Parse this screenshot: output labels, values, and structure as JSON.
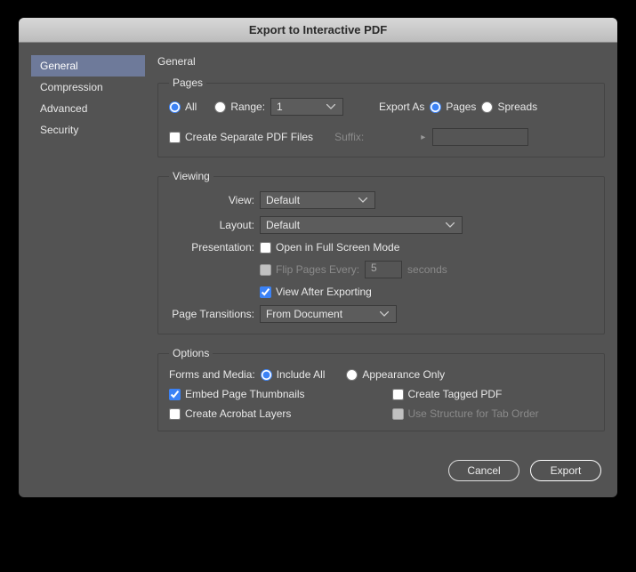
{
  "title": "Export to Interactive PDF",
  "sidebar": {
    "items": [
      {
        "label": "General"
      },
      {
        "label": "Compression"
      },
      {
        "label": "Advanced"
      },
      {
        "label": "Security"
      }
    ]
  },
  "panel": {
    "heading": "General",
    "pages": {
      "legend": "Pages",
      "all_label": "All",
      "range_label": "Range:",
      "range_value": "1",
      "export_as_label": "Export As",
      "pages_label": "Pages",
      "spreads_label": "Spreads",
      "separate_label": "Create Separate PDF Files",
      "suffix_label": "Suffix:",
      "suffix_value": ""
    },
    "viewing": {
      "legend": "Viewing",
      "view_label": "View:",
      "view_value": "Default",
      "layout_label": "Layout:",
      "layout_value": "Default",
      "presentation_label": "Presentation:",
      "fullscreen_label": "Open in Full Screen Mode",
      "flip_label": "Flip Pages Every:",
      "flip_value": "5",
      "seconds_label": "seconds",
      "view_after_label": "View After Exporting",
      "transitions_label": "Page Transitions:",
      "transitions_value": "From Document"
    },
    "options": {
      "legend": "Options",
      "forms_label": "Forms and Media:",
      "include_all_label": "Include All",
      "appearance_label": "Appearance Only",
      "embed_thumbs_label": "Embed Page Thumbnails",
      "tagged_pdf_label": "Create Tagged PDF",
      "acrobat_layers_label": "Create Acrobat Layers",
      "structure_tab_label": "Use Structure for Tab Order"
    }
  },
  "footer": {
    "cancel": "Cancel",
    "export": "Export"
  }
}
